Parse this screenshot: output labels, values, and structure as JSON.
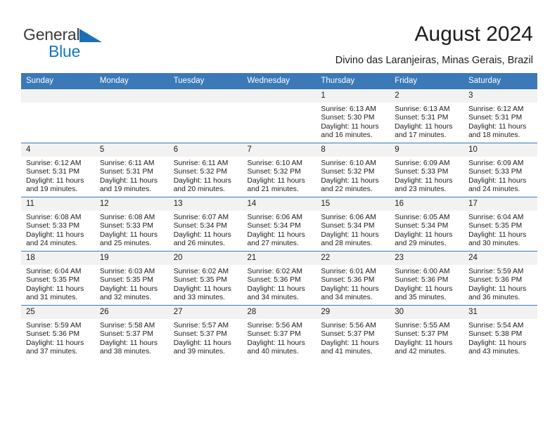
{
  "brand": {
    "name_part1": "General",
    "name_part2": "Blue",
    "triangle_icon": "triangle-icon",
    "colors": {
      "text": "#3a3a3a",
      "blue": "#1277c4"
    }
  },
  "header": {
    "title": "August 2024",
    "subtitle": "Divino das Laranjeiras, Minas Gerais, Brazil"
  },
  "theme": {
    "header_blue": "#3b79b8",
    "daynum_gray": "#f2f2f2",
    "text": "#1c1c1c"
  },
  "calendar": {
    "weekday_headers": [
      "Sunday",
      "Monday",
      "Tuesday",
      "Wednesday",
      "Thursday",
      "Friday",
      "Saturday"
    ],
    "labels": {
      "sunrise": "Sunrise:",
      "sunset": "Sunset:",
      "daylight": "Daylight:"
    },
    "weeks": [
      [
        {
          "day": "",
          "empty": true
        },
        {
          "day": "",
          "empty": true
        },
        {
          "day": "",
          "empty": true
        },
        {
          "day": "",
          "empty": true
        },
        {
          "day": "1",
          "sunrise": "Sunrise: 6:13 AM",
          "sunset": "Sunset: 5:30 PM",
          "daylight_line1": "Daylight: 11 hours",
          "daylight_line2": "and 16 minutes."
        },
        {
          "day": "2",
          "sunrise": "Sunrise: 6:13 AM",
          "sunset": "Sunset: 5:31 PM",
          "daylight_line1": "Daylight: 11 hours",
          "daylight_line2": "and 17 minutes."
        },
        {
          "day": "3",
          "sunrise": "Sunrise: 6:12 AM",
          "sunset": "Sunset: 5:31 PM",
          "daylight_line1": "Daylight: 11 hours",
          "daylight_line2": "and 18 minutes."
        }
      ],
      [
        {
          "day": "4",
          "sunrise": "Sunrise: 6:12 AM",
          "sunset": "Sunset: 5:31 PM",
          "daylight_line1": "Daylight: 11 hours",
          "daylight_line2": "and 19 minutes."
        },
        {
          "day": "5",
          "sunrise": "Sunrise: 6:11 AM",
          "sunset": "Sunset: 5:31 PM",
          "daylight_line1": "Daylight: 11 hours",
          "daylight_line2": "and 19 minutes."
        },
        {
          "day": "6",
          "sunrise": "Sunrise: 6:11 AM",
          "sunset": "Sunset: 5:32 PM",
          "daylight_line1": "Daylight: 11 hours",
          "daylight_line2": "and 20 minutes."
        },
        {
          "day": "7",
          "sunrise": "Sunrise: 6:10 AM",
          "sunset": "Sunset: 5:32 PM",
          "daylight_line1": "Daylight: 11 hours",
          "daylight_line2": "and 21 minutes."
        },
        {
          "day": "8",
          "sunrise": "Sunrise: 6:10 AM",
          "sunset": "Sunset: 5:32 PM",
          "daylight_line1": "Daylight: 11 hours",
          "daylight_line2": "and 22 minutes."
        },
        {
          "day": "9",
          "sunrise": "Sunrise: 6:09 AM",
          "sunset": "Sunset: 5:33 PM",
          "daylight_line1": "Daylight: 11 hours",
          "daylight_line2": "and 23 minutes."
        },
        {
          "day": "10",
          "sunrise": "Sunrise: 6:09 AM",
          "sunset": "Sunset: 5:33 PM",
          "daylight_line1": "Daylight: 11 hours",
          "daylight_line2": "and 24 minutes."
        }
      ],
      [
        {
          "day": "11",
          "sunrise": "Sunrise: 6:08 AM",
          "sunset": "Sunset: 5:33 PM",
          "daylight_line1": "Daylight: 11 hours",
          "daylight_line2": "and 24 minutes."
        },
        {
          "day": "12",
          "sunrise": "Sunrise: 6:08 AM",
          "sunset": "Sunset: 5:33 PM",
          "daylight_line1": "Daylight: 11 hours",
          "daylight_line2": "and 25 minutes."
        },
        {
          "day": "13",
          "sunrise": "Sunrise: 6:07 AM",
          "sunset": "Sunset: 5:34 PM",
          "daylight_line1": "Daylight: 11 hours",
          "daylight_line2": "and 26 minutes."
        },
        {
          "day": "14",
          "sunrise": "Sunrise: 6:06 AM",
          "sunset": "Sunset: 5:34 PM",
          "daylight_line1": "Daylight: 11 hours",
          "daylight_line2": "and 27 minutes."
        },
        {
          "day": "15",
          "sunrise": "Sunrise: 6:06 AM",
          "sunset": "Sunset: 5:34 PM",
          "daylight_line1": "Daylight: 11 hours",
          "daylight_line2": "and 28 minutes."
        },
        {
          "day": "16",
          "sunrise": "Sunrise: 6:05 AM",
          "sunset": "Sunset: 5:34 PM",
          "daylight_line1": "Daylight: 11 hours",
          "daylight_line2": "and 29 minutes."
        },
        {
          "day": "17",
          "sunrise": "Sunrise: 6:04 AM",
          "sunset": "Sunset: 5:35 PM",
          "daylight_line1": "Daylight: 11 hours",
          "daylight_line2": "and 30 minutes."
        }
      ],
      [
        {
          "day": "18",
          "sunrise": "Sunrise: 6:04 AM",
          "sunset": "Sunset: 5:35 PM",
          "daylight_line1": "Daylight: 11 hours",
          "daylight_line2": "and 31 minutes."
        },
        {
          "day": "19",
          "sunrise": "Sunrise: 6:03 AM",
          "sunset": "Sunset: 5:35 PM",
          "daylight_line1": "Daylight: 11 hours",
          "daylight_line2": "and 32 minutes."
        },
        {
          "day": "20",
          "sunrise": "Sunrise: 6:02 AM",
          "sunset": "Sunset: 5:35 PM",
          "daylight_line1": "Daylight: 11 hours",
          "daylight_line2": "and 33 minutes."
        },
        {
          "day": "21",
          "sunrise": "Sunrise: 6:02 AM",
          "sunset": "Sunset: 5:36 PM",
          "daylight_line1": "Daylight: 11 hours",
          "daylight_line2": "and 34 minutes."
        },
        {
          "day": "22",
          "sunrise": "Sunrise: 6:01 AM",
          "sunset": "Sunset: 5:36 PM",
          "daylight_line1": "Daylight: 11 hours",
          "daylight_line2": "and 34 minutes."
        },
        {
          "day": "23",
          "sunrise": "Sunrise: 6:00 AM",
          "sunset": "Sunset: 5:36 PM",
          "daylight_line1": "Daylight: 11 hours",
          "daylight_line2": "and 35 minutes."
        },
        {
          "day": "24",
          "sunrise": "Sunrise: 5:59 AM",
          "sunset": "Sunset: 5:36 PM",
          "daylight_line1": "Daylight: 11 hours",
          "daylight_line2": "and 36 minutes."
        }
      ],
      [
        {
          "day": "25",
          "sunrise": "Sunrise: 5:59 AM",
          "sunset": "Sunset: 5:36 PM",
          "daylight_line1": "Daylight: 11 hours",
          "daylight_line2": "and 37 minutes."
        },
        {
          "day": "26",
          "sunrise": "Sunrise: 5:58 AM",
          "sunset": "Sunset: 5:37 PM",
          "daylight_line1": "Daylight: 11 hours",
          "daylight_line2": "and 38 minutes."
        },
        {
          "day": "27",
          "sunrise": "Sunrise: 5:57 AM",
          "sunset": "Sunset: 5:37 PM",
          "daylight_line1": "Daylight: 11 hours",
          "daylight_line2": "and 39 minutes."
        },
        {
          "day": "28",
          "sunrise": "Sunrise: 5:56 AM",
          "sunset": "Sunset: 5:37 PM",
          "daylight_line1": "Daylight: 11 hours",
          "daylight_line2": "and 40 minutes."
        },
        {
          "day": "29",
          "sunrise": "Sunrise: 5:56 AM",
          "sunset": "Sunset: 5:37 PM",
          "daylight_line1": "Daylight: 11 hours",
          "daylight_line2": "and 41 minutes."
        },
        {
          "day": "30",
          "sunrise": "Sunrise: 5:55 AM",
          "sunset": "Sunset: 5:37 PM",
          "daylight_line1": "Daylight: 11 hours",
          "daylight_line2": "and 42 minutes."
        },
        {
          "day": "31",
          "sunrise": "Sunrise: 5:54 AM",
          "sunset": "Sunset: 5:38 PM",
          "daylight_line1": "Daylight: 11 hours",
          "daylight_line2": "and 43 minutes."
        }
      ]
    ]
  }
}
